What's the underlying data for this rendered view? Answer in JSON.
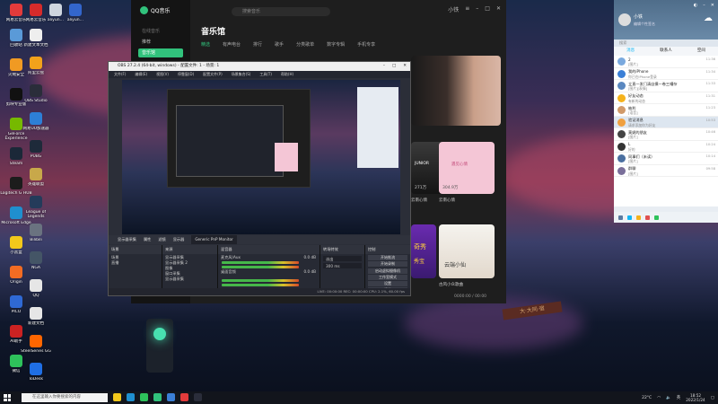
{
  "desktop": {
    "icons": [
      {
        "label": "网易云音乐",
        "color": "#e33b3b"
      },
      {
        "label": "网易云音乐",
        "color": "#d62b2b"
      },
      {
        "label": "aliyun…",
        "color": "#cfd6df"
      },
      {
        "label": "aliyun…",
        "color": "#3366cc"
      },
      {
        "label": "回收站",
        "color": "#5a9ad8"
      },
      {
        "label": "新建文本文档",
        "color": "#eeeeee"
      },
      {
        "label": "火绒安全",
        "color": "#f09a23"
      },
      {
        "label": "阿里云盘",
        "color": "#f2a21b"
      },
      {
        "label": "OBS Studio",
        "color": "#2a2d3a"
      },
      {
        "label": "网易UU加速器",
        "color": "#2d7fd6"
      },
      {
        "label": "剪映专业版",
        "color": "#111111"
      },
      {
        "label": "PUBG",
        "color": "#1e2a3a"
      },
      {
        "label": "GeForce Experience",
        "color": "#76b900"
      },
      {
        "label": "Steam",
        "color": "#1b2838"
      },
      {
        "label": "Logitech G HUB",
        "color": "#1c1c1c"
      },
      {
        "label": "英雄联盟",
        "color": "#c8a84a"
      },
      {
        "label": "League of Legends",
        "color": "#243b5a"
      },
      {
        "label": "Microsoft Edge",
        "color": "#1f8fcf"
      },
      {
        "label": "Bilibili",
        "color": "#6a7380"
      },
      {
        "label": "小黑盒",
        "color": "#f2c81b"
      },
      {
        "label": "NGA",
        "color": "#445566"
      },
      {
        "label": "Origin",
        "color": "#f26c23"
      },
      {
        "label": "QQ",
        "color": "#e6e6e6"
      },
      {
        "label": "PICO",
        "color": "#2f69d4"
      },
      {
        "label": "新建文档",
        "color": "#e6e6e6"
      },
      {
        "label": "AI助手",
        "color": "#cc2222"
      },
      {
        "label": "SteelSeries GG",
        "color": "#ff6600"
      },
      {
        "label": "微信",
        "color": "#2ec25b"
      },
      {
        "label": "ToDesk",
        "color": "#1f6fe5"
      }
    ],
    "signpost_text": "大·大同·宿"
  },
  "qqmusic": {
    "app_name": "QQ音乐",
    "sidebar_section": "在线音乐",
    "sidebar_items": [
      "推荐",
      "音乐馆"
    ],
    "search_placeholder": "搜索音乐",
    "title": "音乐馆",
    "tabs": [
      "精选",
      "有声电台",
      "排行",
      "歌手",
      "分类歌单",
      "数字专辑",
      "手机专享"
    ],
    "cards": [
      {
        "caption": "JUNIOR",
        "sub": "271万"
      },
      {
        "caption": "遇见心情",
        "sub": "304.9万"
      },
      {
        "caption": "云南心情"
      },
      {
        "caption": "云南心情"
      },
      {
        "caption": "奇秀",
        "sub": "秀宝"
      },
      {
        "caption": "云端小仙"
      },
      {
        "caption": "古风小众歌曲"
      }
    ],
    "user": "小铁",
    "player_time": "0000:00 / 00:00"
  },
  "obs": {
    "title": "OBS 27.2.4 (64-bit, windows) - 配置文件: 1 - 场景: 1",
    "menu": [
      "文件(F)",
      "编辑(E)",
      "视图(V)",
      "停靠窗(D)",
      "配置文件(P)",
      "场景集合(S)",
      "工具(T)",
      "帮助(H)"
    ],
    "source_bar": [
      "显示器采集",
      "属性",
      "滤镜",
      "显示器",
      "Generic PnP Monitor"
    ],
    "docks": {
      "scenes": {
        "header": "场景",
        "items": [
          "场景",
          "直播"
        ]
      },
      "sources": {
        "header": "来源",
        "items": [
          "显示器采集",
          "显示器采集 2",
          "图像",
          "窗口采集",
          "显示器采集"
        ]
      },
      "mixer": {
        "header": "混音器",
        "channels": [
          {
            "name": "麦克风/Aux",
            "db": "0.0 dB"
          },
          {
            "name": "桌面音频",
            "db": "0.0 dB"
          }
        ]
      },
      "transitions": {
        "header": "转场特效",
        "type": "淡出",
        "duration": "300 ms"
      },
      "controls": {
        "header": "控制",
        "buttons": [
          "开始推流",
          "开始录制",
          "启动虚拟摄像机",
          "工作室模式",
          "设置",
          "退出"
        ]
      }
    },
    "status": "LIVE: 00:00:00   REC: 00:00:00   CPU: 2.1%, 60.00 fps"
  },
  "qq": {
    "nickname": "小铁",
    "signature": "编辑个性签名",
    "search_placeholder": "搜索",
    "tabs": [
      "消息",
      "联系人",
      "空间"
    ],
    "conversations": [
      {
        "name": "2",
        "msg": "[图片]",
        "time": "11:36",
        "color": "#7aa9de"
      },
      {
        "name": "我的iPhone",
        "msg": "你已在iPhone登录",
        "time": "11:34",
        "color": "#3b7fd6"
      },
      {
        "name": "立直一发门清自摸一卷三嘈杂",
        "msg": "[图片][表情]",
        "time": "11:33",
        "color": "#5a88c0"
      },
      {
        "name": "好友动态",
        "msg": "有新的动态",
        "time": "11:31",
        "color": "#f5b21b"
      },
      {
        "name": "柚利",
        "msg": "[语音]",
        "time": "11:23",
        "color": "#d19a6a"
      },
      {
        "name": "验证消息",
        "msg": "请求添加你为好友",
        "time": "10:53",
        "color": "#f0a040"
      },
      {
        "name": "莫妮的朋友",
        "msg": "[图片]",
        "time": "10:46",
        "color": "#444444"
      },
      {
        "name": "L",
        "msg": "好的",
        "time": "10:24",
        "color": "#333333"
      },
      {
        "name": "同事们（未读）",
        "msg": "[图片]",
        "time": "10:14",
        "color": "#4a6fa0"
      },
      {
        "name": "群聊",
        "msg": "[图片]",
        "time": "09:58",
        "color": "#7a6f9a"
      }
    ]
  },
  "taskbar": {
    "search_placeholder": "在这里输入你要搜索的内容",
    "apps_colors": [
      "#f2c81b",
      "#1f8fcf",
      "#2ec25b",
      "#31c27c",
      "#3b7fd6",
      "#e33b3b",
      "#2a2d3a"
    ],
    "weather": "22°C",
    "lang": "英",
    "time": "18:52",
    "date": "2022/1/24"
  }
}
